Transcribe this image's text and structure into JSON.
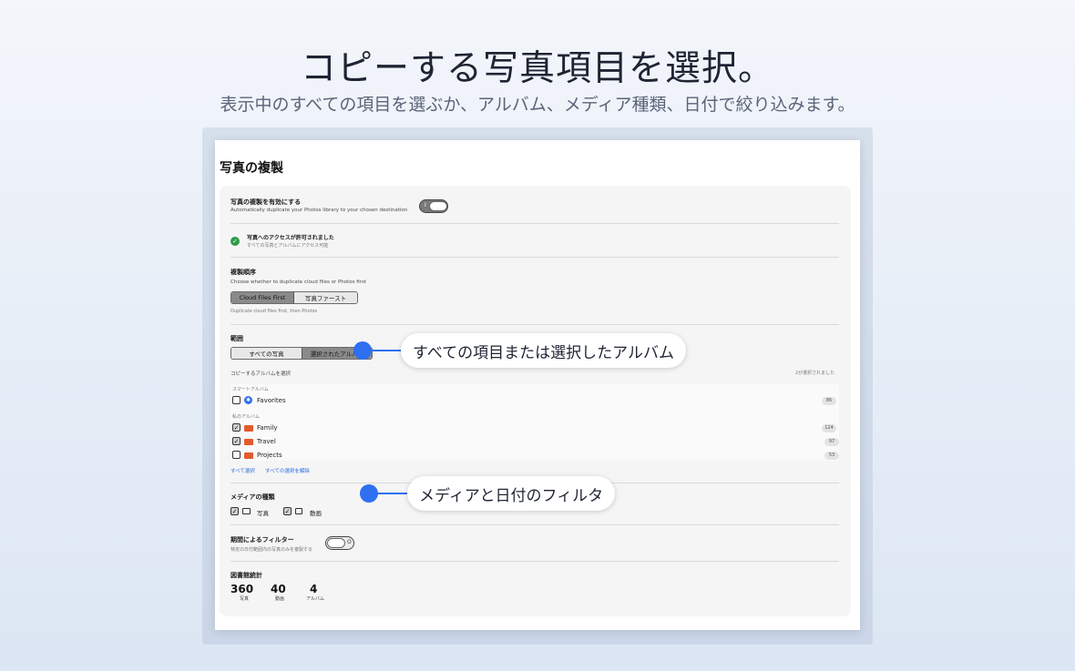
{
  "hero": {
    "title": "コピーする写真項目を選択。",
    "subtitle": "表示中のすべての項目を選ぶか、アルバム、メディア種類、日付で絞り込みます。"
  },
  "window": {
    "title": "写真の複製"
  },
  "enable": {
    "label": "写真の複製を有効にする",
    "desc": "Automatically duplicate your Photos library to your chosen destination",
    "toggle_mark": "I"
  },
  "access": {
    "title": "写真へのアクセスが許可されました",
    "desc": "すべての写真とアルバムにアクセス可能"
  },
  "order": {
    "label": "複製順序",
    "desc": "Choose whether to duplicate cloud files or Photos first",
    "options": [
      "Cloud Files First",
      "写真ファースト"
    ],
    "selected": "Cloud Files First",
    "note": "Duplicate cloud files first, then Photos"
  },
  "scope": {
    "label": "範囲",
    "options": [
      "すべての写真",
      "選択されたアルバム"
    ],
    "selected": "選択されたアルバム",
    "album_prompt": "コピーするアルバムを選択",
    "selected_count": "2が選択されました"
  },
  "albums": {
    "smart_header": "スマートアルバム",
    "my_header": "私のアルバム",
    "smart": [
      {
        "name": "Favorites",
        "count": "86",
        "checked": false
      }
    ],
    "mine": [
      {
        "name": "Family",
        "count": "124",
        "checked": true
      },
      {
        "name": "Travel",
        "count": "97",
        "checked": true
      },
      {
        "name": "Projects",
        "count": "53",
        "checked": false
      }
    ],
    "select_all": "すべて選択",
    "deselect_all": "すべての選択を解除"
  },
  "media": {
    "label": "メディアの種類",
    "photo": "写真",
    "video": "動画"
  },
  "date_filter": {
    "label": "期間によるフィルター",
    "desc": "特定の日付範囲内の写真のみを複製する",
    "toggle_mark": "O"
  },
  "stats": {
    "label": "図書館統計",
    "items": [
      {
        "value": "360",
        "label": "写真"
      },
      {
        "value": "40",
        "label": "動画"
      },
      {
        "value": "4",
        "label": "アルバム"
      }
    ]
  },
  "callouts": {
    "scope": "すべての項目または選択したアルバム",
    "media": "メディアと日付のフィルタ"
  },
  "colors": {
    "accent": "#2f6ff2",
    "success": "#2e9b4a",
    "folder": "#e35b2d",
    "link": "#2a6de0"
  }
}
